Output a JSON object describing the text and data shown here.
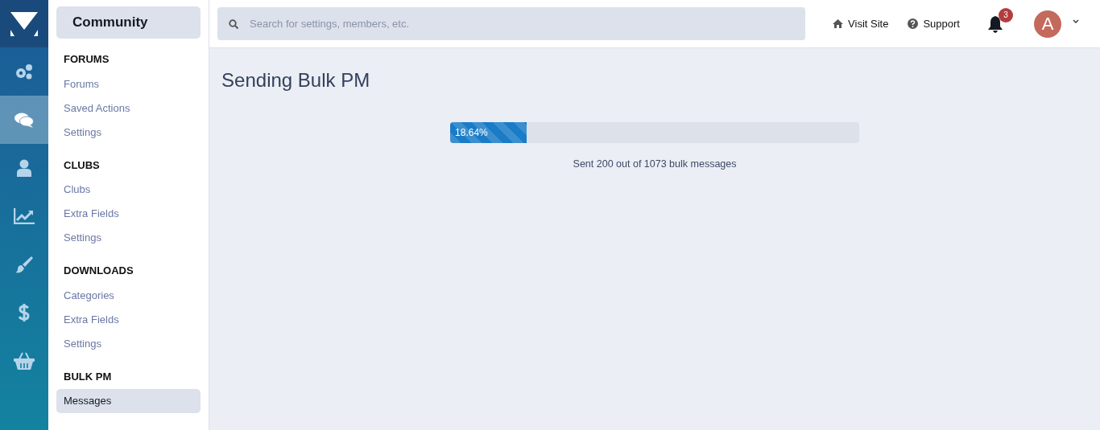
{
  "rail": [
    {
      "kind": "gears",
      "selected": false
    },
    {
      "kind": "chat",
      "selected": true
    },
    {
      "kind": "user",
      "selected": false
    },
    {
      "kind": "chart",
      "selected": false
    },
    {
      "kind": "brush",
      "selected": false
    },
    {
      "kind": "dollar",
      "selected": false
    },
    {
      "kind": "basket",
      "selected": false
    }
  ],
  "sidebar": {
    "title": "Community",
    "sections": [
      {
        "heading": "FORUMS",
        "items": [
          {
            "label": "Forums",
            "selected": false
          },
          {
            "label": "Saved Actions",
            "selected": false
          },
          {
            "label": "Settings",
            "selected": false
          }
        ]
      },
      {
        "heading": "CLUBS",
        "items": [
          {
            "label": "Clubs",
            "selected": false
          },
          {
            "label": "Extra Fields",
            "selected": false
          },
          {
            "label": "Settings",
            "selected": false
          }
        ]
      },
      {
        "heading": "DOWNLOADS",
        "items": [
          {
            "label": "Categories",
            "selected": false
          },
          {
            "label": "Extra Fields",
            "selected": false
          },
          {
            "label": "Settings",
            "selected": false
          }
        ]
      },
      {
        "heading": "BULK PM",
        "items": [
          {
            "label": "Messages",
            "selected": true
          }
        ]
      }
    ]
  },
  "header": {
    "search": {
      "placeholder": "Search for settings, members, etc."
    },
    "links": [
      {
        "kind": "home",
        "label": "Visit Site"
      },
      {
        "kind": "help",
        "label": "Support"
      }
    ],
    "notifications": {
      "count": "3"
    },
    "avatar": {
      "letter": "A"
    }
  },
  "page": {
    "title": "Sending Bulk PM",
    "progress": {
      "level": 0.1864,
      "reading": "18.64%"
    },
    "status": "Sent 200 out of 1073 bulk messages"
  }
}
